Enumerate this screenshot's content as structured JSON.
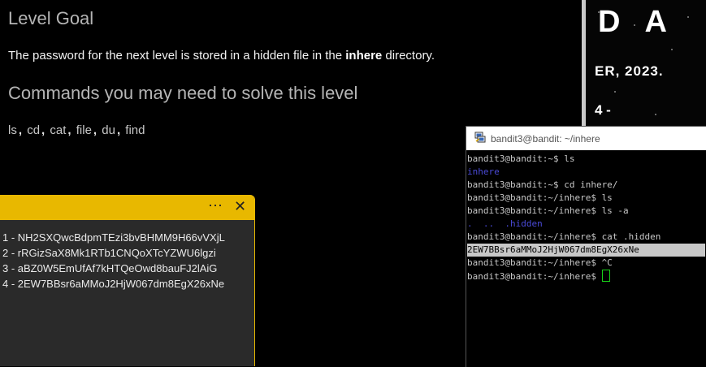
{
  "page": {
    "level_goal_heading": "Level Goal",
    "goal_prefix": "The password for the next level is stored in a hidden file in the ",
    "goal_bold": "inhere",
    "goal_suffix": " directory.",
    "commands_heading": "Commands you may need to solve this level",
    "commands": [
      "ls",
      "cd",
      "cat",
      "file",
      "du",
      "find"
    ],
    "commands_separator": ","
  },
  "banner": {
    "logo_text": "DA",
    "date_text": "ER, 2023.",
    "number_text": "4 -"
  },
  "notes": {
    "more_icon": "⋯",
    "close_icon": "✕",
    "items": [
      "1 - NH2SXQwcBdpmTEzi3bvBHMM9H66vVXjL",
      "2 - rRGizSaX8Mk1RTb1CNQoXTcYZWU6lgzi",
      "3 - aBZ0W5EmUfAf7kHTQeOwd8bauFJ2lAiG",
      "4 - 2EW7BBsr6aMMoJ2HjW067dm8EgX26xNe"
    ]
  },
  "terminal": {
    "title": "bandit3@bandit: ~/inhere",
    "lines": [
      "bandit3@bandit:~$ ls",
      "inhere",
      "bandit3@bandit:~$ cd inhere/",
      "bandit3@bandit:~/inhere$ ls",
      "bandit3@bandit:~/inhere$ ls -a",
      ".  ..  .hidden",
      "bandit3@bandit:~/inhere$ cat .hidden",
      "2EW7BBsr6aMMoJ2HjW067dm8EgX26xNe",
      "bandit3@bandit:~/inhere$ ^C",
      "bandit3@bandit:~/inhere$ "
    ],
    "colors": {
      "dir": "#4a4ad8",
      "cursor": "#18d018",
      "highlight": "#c8c8c8"
    }
  }
}
